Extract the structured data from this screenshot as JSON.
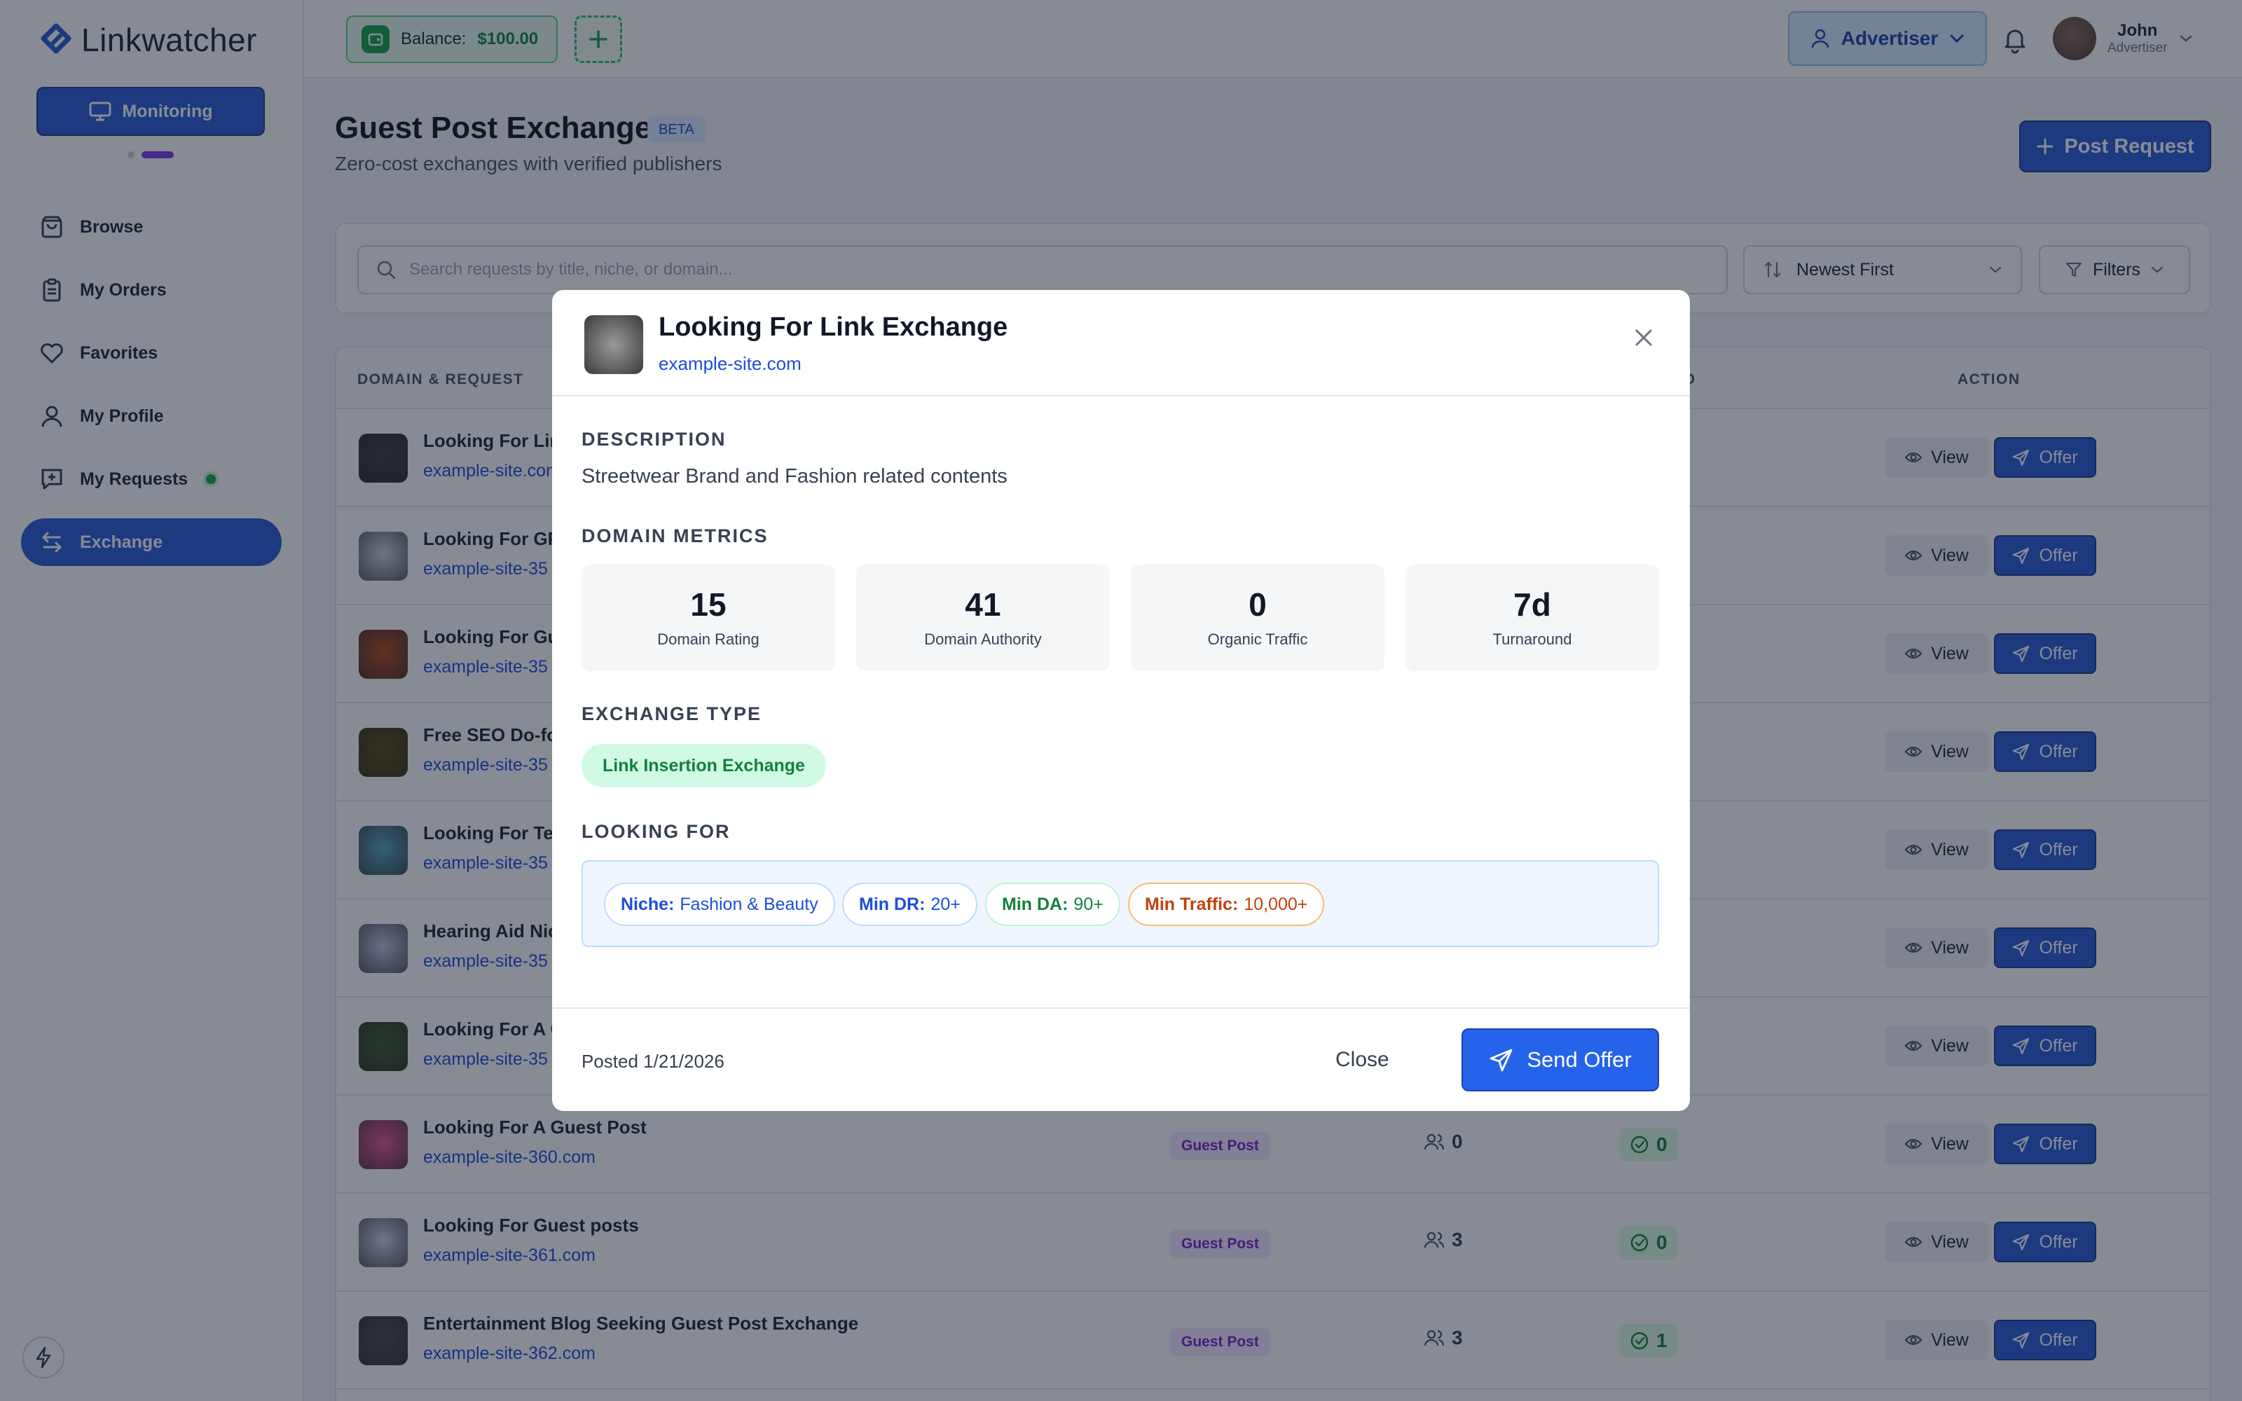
{
  "brand": {
    "name": "Linkwatcher"
  },
  "sidebar": {
    "monitoring_label": "Monitoring",
    "items": [
      {
        "label": "Browse",
        "icon": "bag-icon"
      },
      {
        "label": "My Orders",
        "icon": "clipboard-icon"
      },
      {
        "label": "Favorites",
        "icon": "heart-icon"
      },
      {
        "label": "My Profile",
        "icon": "user-icon"
      },
      {
        "label": "My Requests",
        "icon": "message-plus-icon",
        "status_dot": true
      },
      {
        "label": "Exchange",
        "icon": "exchange-icon",
        "active": true
      }
    ]
  },
  "topbar": {
    "balance_label": "Balance:",
    "balance_value": "$100.00",
    "role_button": "Advertiser",
    "user_name": "John",
    "user_role": "Advertiser"
  },
  "page": {
    "title": "Guest Post Exchange",
    "badge": "BETA",
    "subtitle": "Zero-cost exchanges with verified publishers",
    "post_request": "Post Request"
  },
  "search": {
    "placeholder": "Search requests by title, niche, or domain...",
    "sort_value": "Newest First",
    "filters_label": "Filters"
  },
  "table": {
    "headers": {
      "domain": "DOMAIN & REQUEST",
      "d": "D",
      "action": "ACTION"
    },
    "view_label": "View",
    "offer_label": "Offer",
    "rows": [
      {
        "title": "Looking For Link Exchange",
        "domain": "example-site.com",
        "color": "#3a3a3a"
      },
      {
        "title": "Looking For GP",
        "domain": "example-site-35",
        "color": "#c9d6dc"
      },
      {
        "title": "Looking For Gue",
        "domain": "example-site-35",
        "color": "#b5471d"
      },
      {
        "title": "Free SEO Do-fol",
        "domain": "example-site-35",
        "color": "#5a4a10"
      },
      {
        "title": "Looking For Tec",
        "domain": "example-site-35",
        "color": "#5aa7c0"
      },
      {
        "title": "Hearing Aid Nic",
        "domain": "example-site-35",
        "color": "#c3c6de"
      },
      {
        "title": "Looking For A G",
        "domain": "example-site-35",
        "color": "#3f5a2a"
      },
      {
        "title": "Looking For A Guest Post",
        "domain": "example-site-360.com",
        "color": "#e7568a",
        "tag": "Guest Post",
        "count": "0",
        "accepted": "0"
      },
      {
        "title": "Looking For Guest posts",
        "domain": "example-site-361.com",
        "color": "#cfd2e6",
        "tag": "Guest Post",
        "count": "3",
        "accepted": "0"
      },
      {
        "title": "Entertainment Blog Seeking Guest Post Exchange",
        "domain": "example-site-362.com",
        "color": "#4a4a4a",
        "tag": "Guest Post",
        "count": "3",
        "accepted": "1"
      }
    ]
  },
  "modal": {
    "title": "Looking For Link Exchange",
    "domain": "example-site.com",
    "description_heading": "DESCRIPTION",
    "description": "Streetwear Brand and Fashion related contents",
    "metrics_heading": "DOMAIN METRICS",
    "metrics": [
      {
        "value": "15",
        "label": "Domain Rating"
      },
      {
        "value": "41",
        "label": "Domain Authority"
      },
      {
        "value": "0",
        "label": "Organic Traffic"
      },
      {
        "value": "7d",
        "label": "Turnaround"
      }
    ],
    "exchange_heading": "EXCHANGE TYPE",
    "exchange_type": "Link Insertion Exchange",
    "looking_heading": "LOOKING FOR",
    "chips": [
      {
        "key": "Niche:",
        "value": "Fashion & Beauty",
        "color": "#1d4ed8",
        "border": "#bfdbfe"
      },
      {
        "key": "Min DR:",
        "value": "20+",
        "color": "#1d4ed8",
        "border": "#bfdbfe"
      },
      {
        "key": "Min DA:",
        "value": "90+",
        "color": "#15803d",
        "border": "#bbf7d0"
      },
      {
        "key": "Min Traffic:",
        "value": "10,000+",
        "color": "#c2410c",
        "border": "#fdba74"
      }
    ],
    "posted": "Posted 1/21/2026",
    "close_label": "Close",
    "send_label": "Send Offer"
  }
}
